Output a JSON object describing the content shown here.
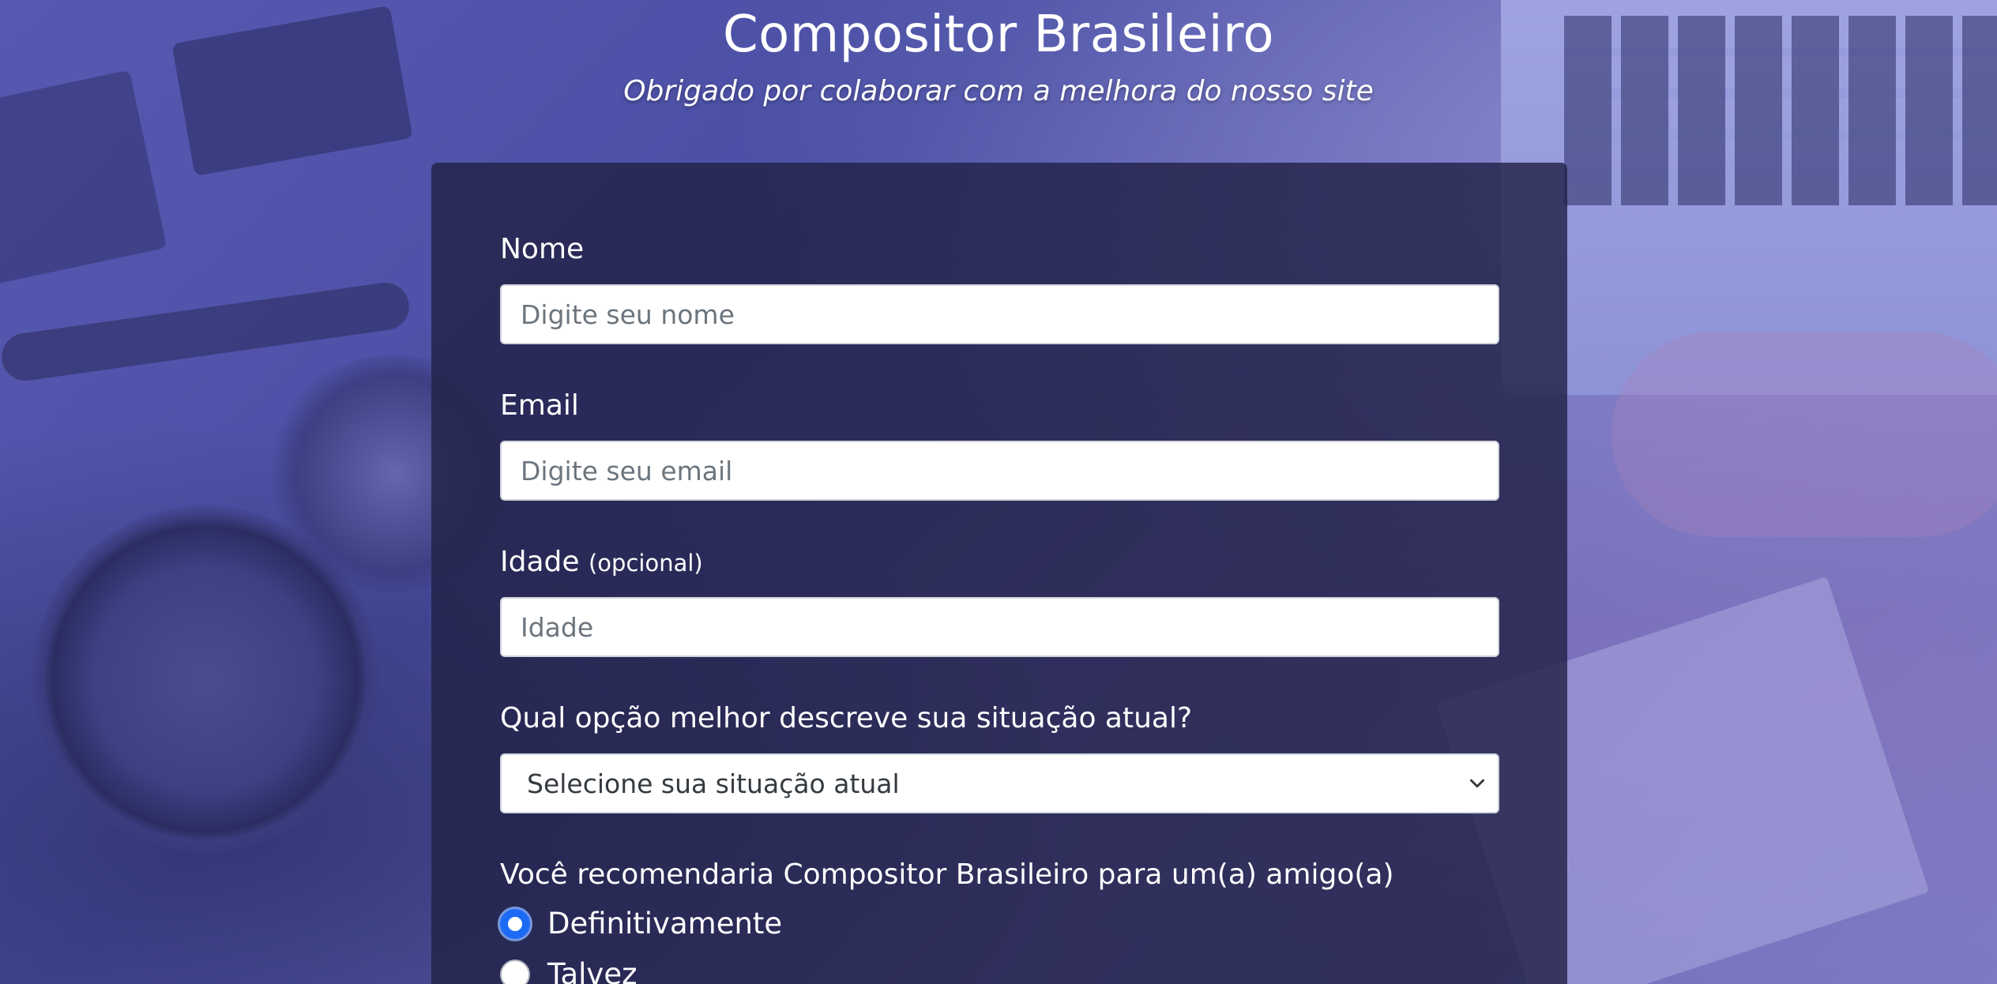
{
  "header": {
    "title": "Compositor Brasileiro",
    "subtitle": "Obrigado por colaborar com a melhora do nosso site"
  },
  "form": {
    "name": {
      "label": "Nome",
      "placeholder": "Digite seu nome"
    },
    "email": {
      "label": "Email",
      "placeholder": "Digite seu email"
    },
    "age": {
      "label": "Idade",
      "optional": "(opcional)",
      "placeholder": "Idade"
    },
    "situation": {
      "label": "Qual opção melhor descreve sua situação atual?",
      "selected": "Selecione sua situação atual"
    },
    "recommend": {
      "label": "Você recomendaria Compositor Brasileiro para um(a) amigo(a)",
      "options": [
        {
          "label": "Definitivamente",
          "checked": true
        },
        {
          "label": "Talvez",
          "checked": false
        }
      ]
    }
  },
  "colors": {
    "accent": "#1d6bf5",
    "card": "#222248",
    "background": "#5659b0"
  }
}
